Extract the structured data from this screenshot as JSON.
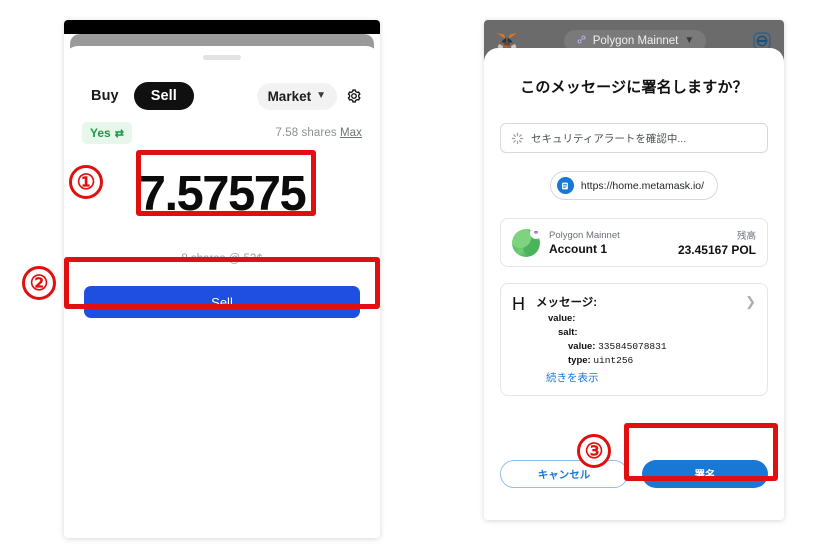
{
  "left_app": {
    "tabs": {
      "buy": "Buy",
      "sell": "Sell"
    },
    "order_type": "Market",
    "gear_icon": "gear-icon",
    "outcome_badge": "Yes",
    "swap_icon": "swap-arrows-icon",
    "shares_available": "7.58 shares",
    "max_label": "Max",
    "amount": "7.57575",
    "sub_line": "8 shares @ 52¢",
    "submit_label": "Sell"
  },
  "right_app": {
    "network": "Polygon Mainnet",
    "network_chain_icon": "chain-link-icon",
    "fox_icon": "metamask-fox-icon",
    "account_icon": "account-identicon-icon",
    "title": "このメッセージに署名しますか？",
    "alert_text": "セキュリティアラートを確認中...",
    "spinner_icon": "loading-spinner-icon",
    "origin_url": "https://home.metamask.io/",
    "origin_icon": "site-badge-icon",
    "account": {
      "network_label": "Polygon Mainnet",
      "name": "Account 1",
      "balance_label": "残高",
      "balance_value": "23.45167 POL"
    },
    "message": {
      "type_letter": "H",
      "heading": "メッセージ:",
      "expand_icon": "chevron-right-icon",
      "rows": [
        {
          "key": "value:",
          "value": "",
          "indent": 1
        },
        {
          "key": "salt:",
          "value": "",
          "indent": 2
        },
        {
          "key": "value:",
          "value": "335845078831",
          "indent": 3
        },
        {
          "key": "type:",
          "value": "uint256",
          "indent": 3
        }
      ],
      "see_more": "続きを表示"
    },
    "cancel_label": "キャンセル",
    "sign_label": "署名"
  },
  "annotations": {
    "steps": [
      {
        "id": "step-1",
        "label": "①"
      },
      {
        "id": "step-2",
        "label": "②"
      },
      {
        "id": "step-3",
        "label": "③"
      }
    ],
    "highlight_color": "#e01010"
  }
}
